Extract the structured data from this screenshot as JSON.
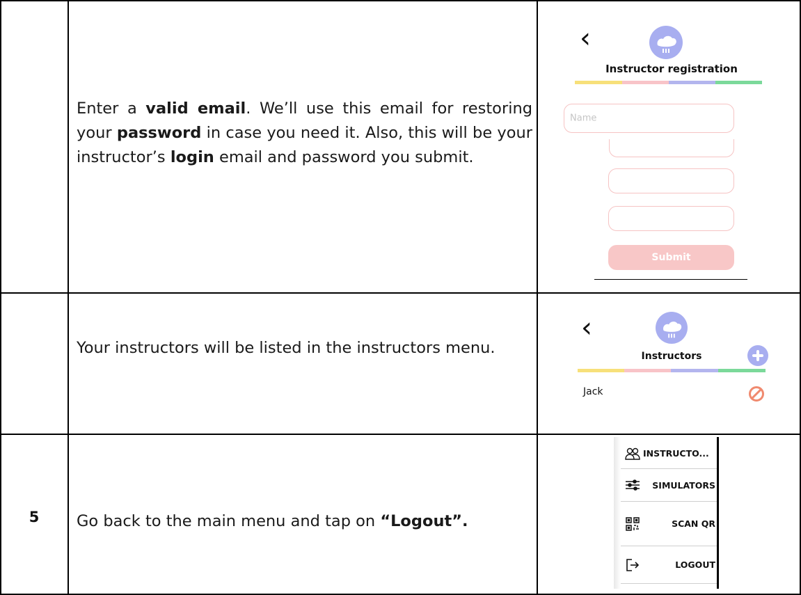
{
  "rows": [
    {
      "step": "",
      "description": {
        "parts": [
          {
            "text": "Enter a ",
            "bold": false
          },
          {
            "text": "valid email",
            "bold": true
          },
          {
            "text": ". We’ll use this email for restoring your ",
            "bold": false
          },
          {
            "text": "password",
            "bold": true
          },
          {
            "text": " in case you need it. Also, this will be your instructor’s ",
            "bold": false
          },
          {
            "text": "login",
            "bold": true
          },
          {
            "text": " email and password you submit.",
            "bold": false
          }
        ]
      },
      "screen": {
        "back": "‹",
        "title": "Instructor registration",
        "name_placeholder": "Name",
        "submit_label": "Submit"
      }
    },
    {
      "step": "",
      "description": {
        "parts": [
          {
            "text": "Your instructors will be listed in the instructors menu.",
            "bold": false
          }
        ]
      },
      "screen": {
        "back": "‹",
        "title": "Instructors",
        "list": [
          "Jack"
        ]
      }
    },
    {
      "step": "5",
      "description": {
        "parts": [
          {
            "text": "Go back to the main menu and tap on ",
            "bold": false
          },
          {
            "text": "“Logout”.",
            "bold": true
          }
        ]
      },
      "menu": {
        "items": [
          {
            "label": "INSTRUCTO...",
            "icon": "people-icon"
          },
          {
            "label": "SIMULATORS",
            "icon": "sliders-icon"
          },
          {
            "label": "SCAN QR",
            "icon": "qr-code-icon"
          },
          {
            "label": "LOGOUT",
            "icon": "logout-icon"
          }
        ]
      }
    }
  ],
  "colors": {
    "stripe": [
      "#f7e07a",
      "#f8c4c8",
      "#b3b5ee",
      "#7bd99a"
    ],
    "accent": "#a8aef0",
    "field_border": "#f6c3c3",
    "submit_bg": "#f8c7c7",
    "delete": "#f08a6f"
  }
}
